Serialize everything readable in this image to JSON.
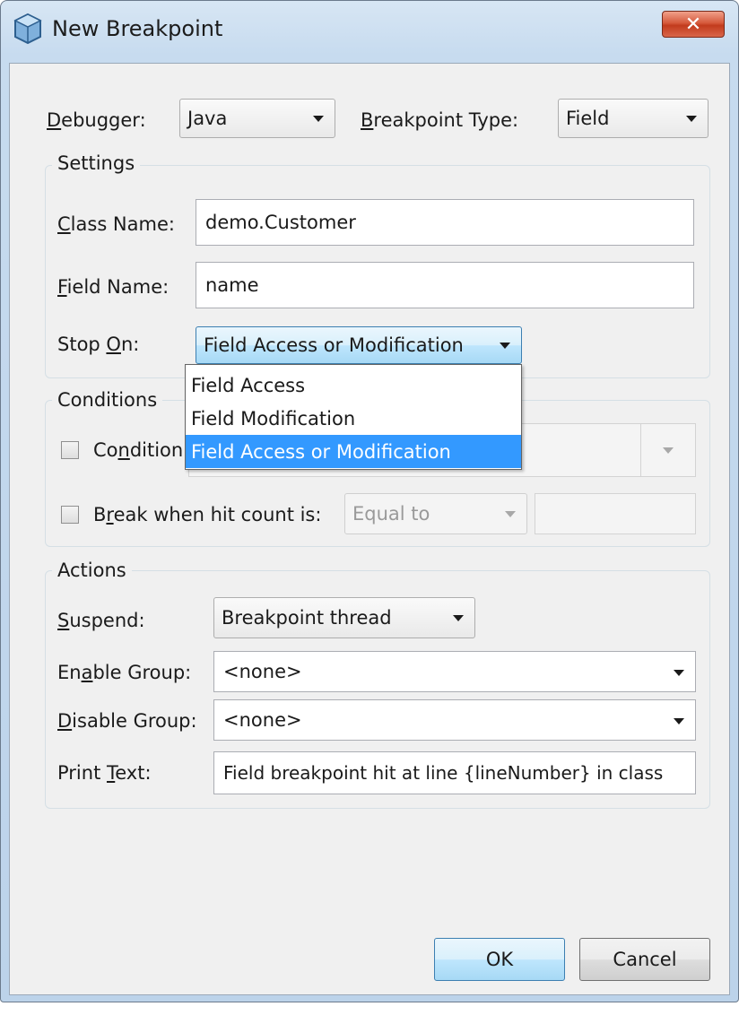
{
  "window": {
    "title": "New Breakpoint",
    "close_label": "✕"
  },
  "top": {
    "debugger_label_u": "D",
    "debugger_label_rest": "ebugger:",
    "debugger_value": "Java",
    "type_label_u": "B",
    "type_label_rest": "reakpoint Type:",
    "type_value": "Field"
  },
  "settings": {
    "title": "Settings",
    "class_label_u": "C",
    "class_label_rest": "lass Name:",
    "class_value": "demo.Customer",
    "field_label_u": "F",
    "field_label_rest": "ield Name:",
    "field_value": "name",
    "stopon_label_pre": "Stop ",
    "stopon_label_u": "O",
    "stopon_label_rest": "n:",
    "stopon_value": "Field Access or Modification",
    "stopon_options": [
      "Field Access",
      "Field Modification",
      "Field Access or Modification"
    ]
  },
  "conditions": {
    "title": "Conditions",
    "condition_label_pre": "Co",
    "condition_label_u": "n",
    "condition_label_rest": "dition:",
    "hitcount_label_pre": "B",
    "hitcount_label_u": "r",
    "hitcount_label_rest": "eak when hit count is:",
    "hitcount_value": "Equal to"
  },
  "actions": {
    "title": "Actions",
    "suspend_label_u": "S",
    "suspend_label_rest": "uspend:",
    "suspend_value": "Breakpoint thread",
    "enable_label_pre": "En",
    "enable_label_u": "a",
    "enable_label_rest": "ble Group:",
    "enable_value": "<none>",
    "disable_label_u": "D",
    "disable_label_rest": "isable Group:",
    "disable_value": "<none>",
    "print_label_pre": "Print ",
    "print_label_u": "T",
    "print_label_rest": "ext:",
    "print_value": "Field breakpoint hit at line {lineNumber} in class"
  },
  "buttons": {
    "ok": "OK",
    "cancel": "Cancel"
  },
  "colors": {
    "selection": "#3399ff",
    "close_button": "#c23b1d",
    "dialog_background": "#f0f0f0"
  }
}
